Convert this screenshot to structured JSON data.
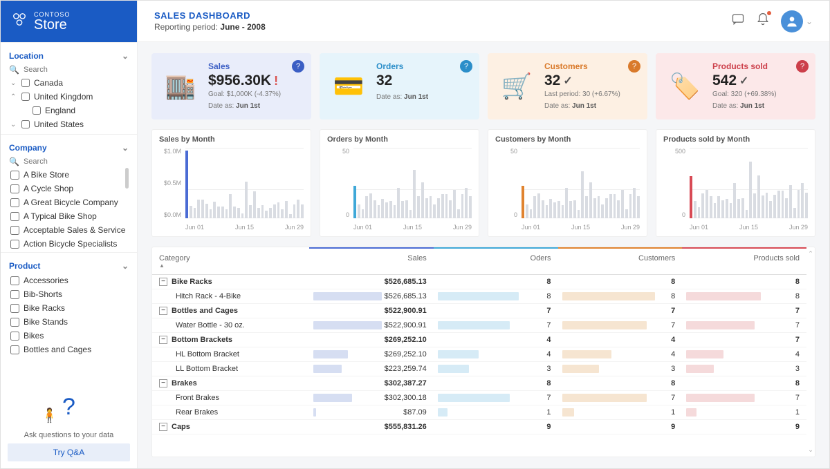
{
  "brand": {
    "small": "CONTOSO",
    "big": "Store"
  },
  "location": {
    "title": "Location",
    "search_placeholder": "Search",
    "items": [
      {
        "label": "Canada",
        "arrow": "down",
        "indent": 0
      },
      {
        "label": "United Kingdom",
        "arrow": "up",
        "indent": 0
      },
      {
        "label": "England",
        "arrow": "",
        "indent": 1
      },
      {
        "label": "United States",
        "arrow": "down",
        "indent": 0
      }
    ]
  },
  "company": {
    "title": "Company",
    "search_placeholder": "Search",
    "items": [
      "A Bike Store",
      "A Cycle Shop",
      "A Great Bicycle Company",
      "A Typical Bike Shop",
      "Acceptable Sales & Service",
      "Action Bicycle Specialists"
    ]
  },
  "product": {
    "title": "Product",
    "items": [
      "Accessories",
      "Bib-Shorts",
      "Bike Racks",
      "Bike Stands",
      "Bikes",
      "Bottles and Cages"
    ]
  },
  "qna": {
    "text": "Ask questions to your data",
    "button": "Try Q&A"
  },
  "header": {
    "title": "SALES DASHBOARD",
    "subtitle_prefix": "Reporting period: ",
    "period": "June - 2008"
  },
  "kpi": {
    "sales": {
      "label": "Sales",
      "value": "$956.30K",
      "indicator": "!",
      "sub": "Goal: $1,000K (-4.37%)",
      "date_label": "Date as:",
      "date": "Jun 1st"
    },
    "orders": {
      "label": "Orders",
      "value": "32",
      "indicator": "",
      "sub": "",
      "date_label": "Date as:",
      "date": "Jun 1st"
    },
    "customers": {
      "label": "Customers",
      "value": "32",
      "indicator": "✓",
      "sub": "Last period: 30 (+6.67%)",
      "date_label": "Date as:",
      "date": "Jun 1st"
    },
    "products": {
      "label": "Products sold",
      "value": "542",
      "indicator": "✓",
      "sub": "Goal: 320 (+69.38%)",
      "date_label": "Date as:",
      "date": "Jun 1st"
    }
  },
  "charts_titles": {
    "sales": "Sales by Month",
    "orders": "Orders by Month",
    "customers": "Customers by Month",
    "products": "Products sold by Month"
  },
  "axis": {
    "sales": [
      "$1.0M",
      "$0.5M",
      "$0.0M"
    ],
    "orders": [
      "50",
      "0"
    ],
    "customers": [
      "50",
      "0"
    ],
    "products": [
      "500",
      "0"
    ],
    "x": [
      "Jun 01",
      "Jun 15",
      "Jun 29"
    ]
  },
  "table": {
    "headers": {
      "category": "Category",
      "sales": "Sales",
      "orders": "Oders",
      "customers": "Customers",
      "products": "Products sold"
    },
    "rows": [
      {
        "type": "group",
        "label": "Bike Racks",
        "sales": "$526,685.13",
        "orders": "8",
        "cust": "8",
        "prod": "8"
      },
      {
        "type": "child",
        "label": "Hitch Rack - 4-Bike",
        "sales": "$526,685.13",
        "orders": "8",
        "cust": "8",
        "prod": "8",
        "bars": {
          "s": 55,
          "o": 65,
          "c": 75,
          "p": 60
        }
      },
      {
        "type": "group",
        "label": "Bottles and Cages",
        "sales": "$522,900.91",
        "orders": "7",
        "cust": "7",
        "prod": "7"
      },
      {
        "type": "child",
        "label": "Water Bottle - 30 oz.",
        "sales": "$522,900.91",
        "orders": "7",
        "cust": "7",
        "prod": "7",
        "bars": {
          "s": 55,
          "o": 58,
          "c": 68,
          "p": 55
        }
      },
      {
        "type": "group",
        "label": "Bottom Brackets",
        "sales": "$269,252.10",
        "orders": "4",
        "cust": "4",
        "prod": "7"
      },
      {
        "type": "child",
        "label": "HL Bottom Bracket",
        "sales": "$269,252.10",
        "orders": "4",
        "cust": "4",
        "prod": "4",
        "bars": {
          "s": 28,
          "o": 33,
          "c": 40,
          "p": 30
        }
      },
      {
        "type": "child",
        "label": "LL Bottom Bracket",
        "sales": "$223,259.74",
        "orders": "3",
        "cust": "3",
        "prod": "3",
        "bars": {
          "s": 23,
          "o": 25,
          "c": 30,
          "p": 22
        }
      },
      {
        "type": "group",
        "label": "Brakes",
        "sales": "$302,387.27",
        "orders": "8",
        "cust": "8",
        "prod": "8"
      },
      {
        "type": "child",
        "label": "Front Brakes",
        "sales": "$302,300.18",
        "orders": "7",
        "cust": "7",
        "prod": "7",
        "bars": {
          "s": 31,
          "o": 58,
          "c": 68,
          "p": 55
        }
      },
      {
        "type": "child",
        "label": "Rear Brakes",
        "sales": "$87.09",
        "orders": "1",
        "cust": "1",
        "prod": "1",
        "bars": {
          "s": 2,
          "o": 8,
          "c": 10,
          "p": 8
        }
      },
      {
        "type": "group",
        "label": "Caps",
        "sales": "$555,831.26",
        "orders": "9",
        "cust": "9",
        "prod": "9"
      }
    ]
  },
  "chart_data": [
    {
      "type": "bar",
      "title": "Sales by Month",
      "xlabel": "",
      "ylabel": "",
      "ylim": [
        0,
        1000000
      ],
      "x": [
        "Jun 01",
        "Jun 02",
        "Jun 03",
        "Jun 04",
        "Jun 05",
        "Jun 06",
        "Jun 07",
        "Jun 08",
        "Jun 09",
        "Jun 10",
        "Jun 11",
        "Jun 12",
        "Jun 13",
        "Jun 14",
        "Jun 15",
        "Jun 16",
        "Jun 17",
        "Jun 18",
        "Jun 19",
        "Jun 20",
        "Jun 21",
        "Jun 22",
        "Jun 23",
        "Jun 24",
        "Jun 25",
        "Jun 26",
        "Jun 27",
        "Jun 28",
        "Jun 29",
        "Jun 30"
      ],
      "values": [
        956300,
        180000,
        150000,
        260000,
        260000,
        210000,
        130000,
        240000,
        170000,
        170000,
        130000,
        340000,
        170000,
        150000,
        70000,
        520000,
        190000,
        380000,
        150000,
        190000,
        110000,
        150000,
        200000,
        230000,
        130000,
        250000,
        60000,
        200000,
        260000,
        200000
      ],
      "highlight_index": 0,
      "highlight_color": "#4a6bd4"
    },
    {
      "type": "bar",
      "title": "Orders by Month",
      "xlabel": "",
      "ylabel": "",
      "ylim": [
        0,
        70
      ],
      "x": [
        "Jun 01",
        "Jun 02",
        "Jun 03",
        "Jun 04",
        "Jun 05",
        "Jun 06",
        "Jun 07",
        "Jun 08",
        "Jun 09",
        "Jun 10",
        "Jun 11",
        "Jun 12",
        "Jun 13",
        "Jun 14",
        "Jun 15",
        "Jun 16",
        "Jun 17",
        "Jun 18",
        "Jun 19",
        "Jun 20",
        "Jun 21",
        "Jun 22",
        "Jun 23",
        "Jun 24",
        "Jun 25",
        "Jun 26",
        "Jun 27",
        "Jun 28",
        "Jun 29",
        "Jun 30"
      ],
      "values": [
        32,
        14,
        9,
        22,
        25,
        18,
        13,
        19,
        16,
        17,
        13,
        30,
        17,
        18,
        8,
        48,
        22,
        36,
        20,
        22,
        14,
        20,
        24,
        24,
        18,
        28,
        9,
        24,
        30,
        22
      ],
      "highlight_index": 0,
      "highlight_color": "#3fa8d8"
    },
    {
      "type": "bar",
      "title": "Customers by Month",
      "xlabel": "",
      "ylabel": "",
      "ylim": [
        0,
        70
      ],
      "x": [
        "Jun 01",
        "Jun 02",
        "Jun 03",
        "Jun 04",
        "Jun 05",
        "Jun 06",
        "Jun 07",
        "Jun 08",
        "Jun 09",
        "Jun 10",
        "Jun 11",
        "Jun 12",
        "Jun 13",
        "Jun 14",
        "Jun 15",
        "Jun 16",
        "Jun 17",
        "Jun 18",
        "Jun 19",
        "Jun 20",
        "Jun 21",
        "Jun 22",
        "Jun 23",
        "Jun 24",
        "Jun 25",
        "Jun 26",
        "Jun 27",
        "Jun 28",
        "Jun 29",
        "Jun 30"
      ],
      "values": [
        32,
        14,
        9,
        22,
        25,
        18,
        13,
        19,
        16,
        17,
        13,
        30,
        17,
        18,
        8,
        47,
        22,
        36,
        20,
        22,
        14,
        20,
        24,
        24,
        18,
        28,
        9,
        24,
        30,
        22
      ],
      "highlight_index": 0,
      "highlight_color": "#e0832f"
    },
    {
      "type": "bar",
      "title": "Products sold by Month",
      "xlabel": "",
      "ylabel": "",
      "ylim": [
        0,
        900
      ],
      "x": [
        "Jun 01",
        "Jun 02",
        "Jun 03",
        "Jun 04",
        "Jun 05",
        "Jun 06",
        "Jun 07",
        "Jun 08",
        "Jun 09",
        "Jun 10",
        "Jun 11",
        "Jun 12",
        "Jun 13",
        "Jun 14",
        "Jun 15",
        "Jun 16",
        "Jun 17",
        "Jun 18",
        "Jun 19",
        "Jun 20",
        "Jun 21",
        "Jun 22",
        "Jun 23",
        "Jun 24",
        "Jun 25",
        "Jun 26",
        "Jun 27",
        "Jun 28",
        "Jun 29",
        "Jun 30"
      ],
      "values": [
        542,
        220,
        140,
        320,
        360,
        280,
        190,
        280,
        230,
        250,
        190,
        450,
        250,
        260,
        110,
        720,
        320,
        550,
        290,
        330,
        220,
        300,
        350,
        350,
        260,
        420,
        130,
        360,
        450,
        330
      ],
      "highlight_index": 0,
      "highlight_color": "#d84a55"
    }
  ]
}
